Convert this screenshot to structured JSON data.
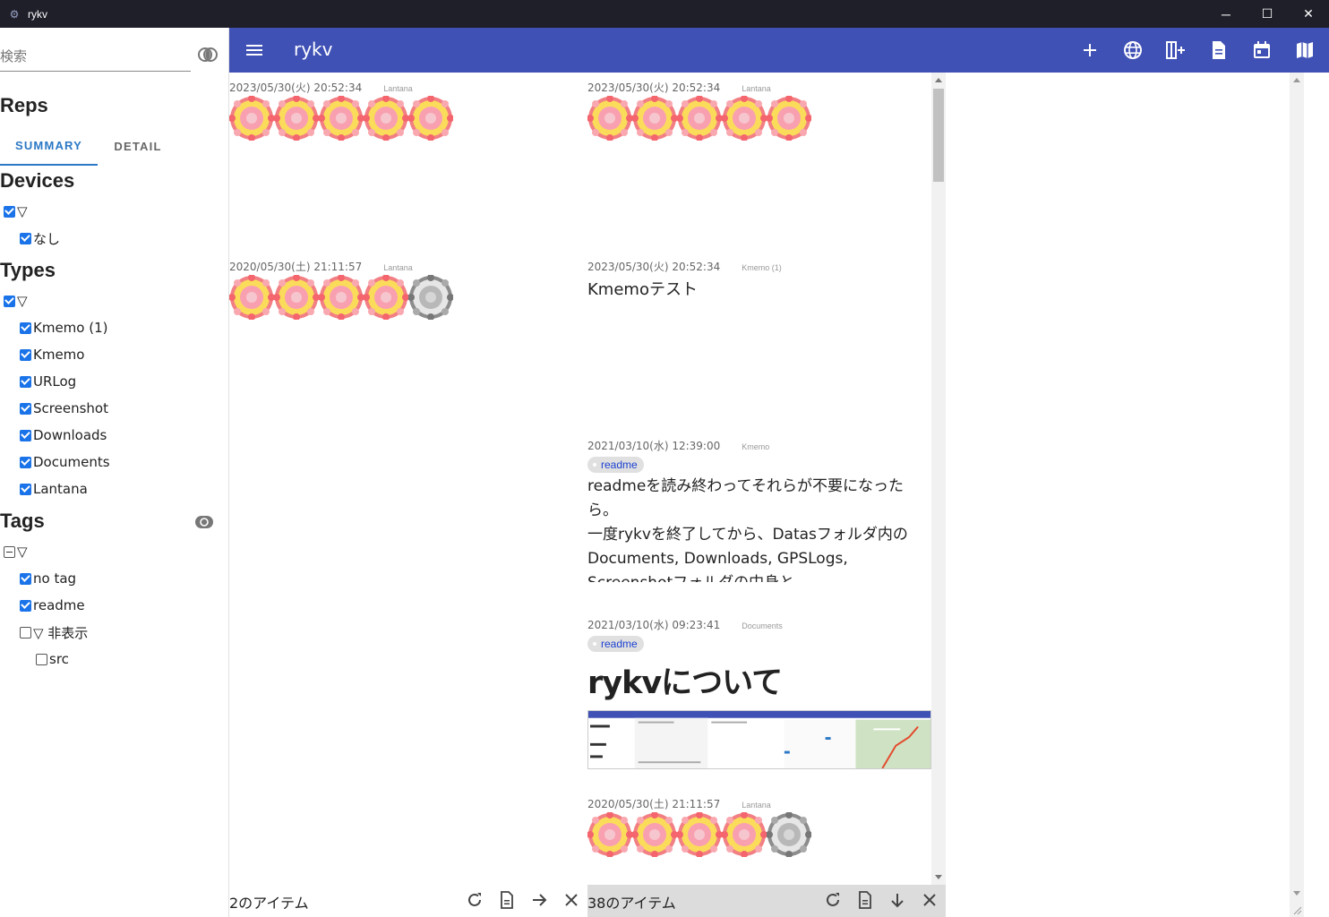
{
  "window": {
    "title": "rykv",
    "controls": {
      "minimize": "─",
      "maximize": "☐",
      "close": "✕"
    }
  },
  "sidebar": {
    "search": {
      "placeholder": "検索",
      "value": ""
    },
    "reps_title": "Reps",
    "tabs": [
      {
        "label": "SUMMARY",
        "active": true
      },
      {
        "label": "DETAIL",
        "active": false
      }
    ],
    "devices": {
      "title": "Devices",
      "root_label": "▽",
      "items": [
        {
          "label": "なし",
          "checked": true
        }
      ]
    },
    "types": {
      "title": "Types",
      "root_label": "▽",
      "items": [
        {
          "label": "Kmemo (1)",
          "checked": true
        },
        {
          "label": "Kmemo",
          "checked": true
        },
        {
          "label": "URLog",
          "checked": true
        },
        {
          "label": "Screenshot",
          "checked": true
        },
        {
          "label": "Downloads",
          "checked": true
        },
        {
          "label": "Documents",
          "checked": true
        },
        {
          "label": "Lantana",
          "checked": true
        }
      ]
    },
    "tags": {
      "title": "Tags",
      "root_label": "▽",
      "items": [
        {
          "label": "no tag",
          "checked": true
        },
        {
          "label": "readme",
          "checked": true
        },
        {
          "label": "▽ 非表示",
          "checked": false
        },
        {
          "label": "src",
          "checked": false
        }
      ]
    }
  },
  "appbar": {
    "title": "rykv",
    "actions": [
      "add-icon",
      "globe-icon",
      "add-column-icon",
      "document-icon",
      "calendar-icon",
      "map-icon"
    ]
  },
  "column1": {
    "items": [
      {
        "time": "2023/05/30(火) 20:52:34",
        "rep": "Lantana",
        "stars": [
          "color",
          "color",
          "color",
          "color",
          "color"
        ]
      },
      {
        "time": "2020/05/30(土) 21:11:57",
        "rep": "Lantana",
        "stars": [
          "color",
          "color",
          "color",
          "color",
          "gray"
        ]
      }
    ],
    "footer_count": "2のアイテム"
  },
  "column2": {
    "lantana1": {
      "time": "2023/05/30(火) 20:52:34",
      "rep": "Lantana"
    },
    "kmemo": {
      "time": "2023/05/30(火) 20:52:34",
      "rep": "Kmemo (1)",
      "text": "Kmemoテスト"
    },
    "readme": {
      "time": "2021/03/10(水) 12:39:00",
      "rep": "Kmemo",
      "tag": "readme",
      "line1": "readmeを読み終わってそれらが不要になったら。",
      "line2": "一度rykvを終了してから、Datasフォルダ内のDocuments, Downloads, GPSLogs, Screenshotフォルダの中身と"
    },
    "document": {
      "time": "2021/03/10(水) 09:23:41",
      "rep": "Documents",
      "tag": "readme",
      "title": "rykvについて"
    },
    "lantana2": {
      "time": "2020/05/30(土) 21:11:57",
      "rep": "Lantana"
    },
    "footer_count": "38のアイテム"
  },
  "colors": {
    "appbar": "#3f51b5",
    "accent": "#2b78c5",
    "checkbox": "#1a73e8",
    "tag_text": "#1a3fd0"
  }
}
